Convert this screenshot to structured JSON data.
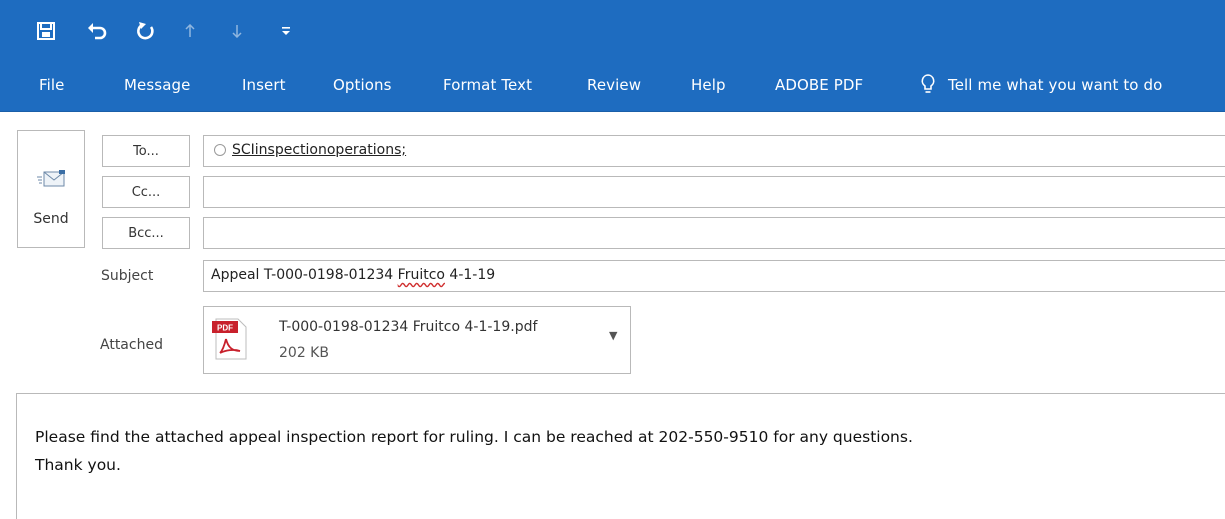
{
  "quick_access": {
    "items": [
      {
        "name": "save-icon",
        "glyph": "🖫"
      },
      {
        "name": "undo-icon",
        "glyph": "↶"
      },
      {
        "name": "redo-icon",
        "glyph": "↻"
      },
      {
        "name": "arrow-up-icon",
        "glyph": "↑"
      },
      {
        "name": "arrow-down-icon",
        "glyph": "↓"
      },
      {
        "name": "customize-qat-icon",
        "glyph": "="
      }
    ]
  },
  "ribbon": {
    "tabs": [
      "File",
      "Message",
      "Insert",
      "Options",
      "Format Text",
      "Review",
      "Help",
      "ADOBE PDF"
    ],
    "tell_me": "Tell me what you want to do",
    "tell_me_icon": "lightbulb-icon"
  },
  "compose": {
    "send_label": "Send",
    "send_icon": "send-envelope-icon",
    "to_button": "To...",
    "cc_button": "Cc...",
    "bcc_button": "Bcc...",
    "to_recipient": "SCIinspectionoperations;",
    "cc_value": "",
    "bcc_value": "",
    "subject_label": "Subject",
    "subject_value_prefix": "Appeal T-000-0198-01234 ",
    "subject_value_misspelled": "Fruitco",
    "subject_value_suffix": " 4-1-19",
    "attached_label": "Attached",
    "attachment": {
      "icon": "pdf-file-icon",
      "icon_badge": "PDF",
      "filename": "T-000-0198-01234 Fruitco 4-1-19.pdf",
      "size": "202 KB"
    },
    "body_lines": [
      "Please find the attached appeal inspection report for ruling.  I can be reached at 202-550-9510 for any questions.",
      "Thank you."
    ]
  },
  "colors": {
    "ribbon_blue": "#1e6cc0",
    "border_gray": "#b9b9b9",
    "pdf_red": "#c8202b"
  }
}
